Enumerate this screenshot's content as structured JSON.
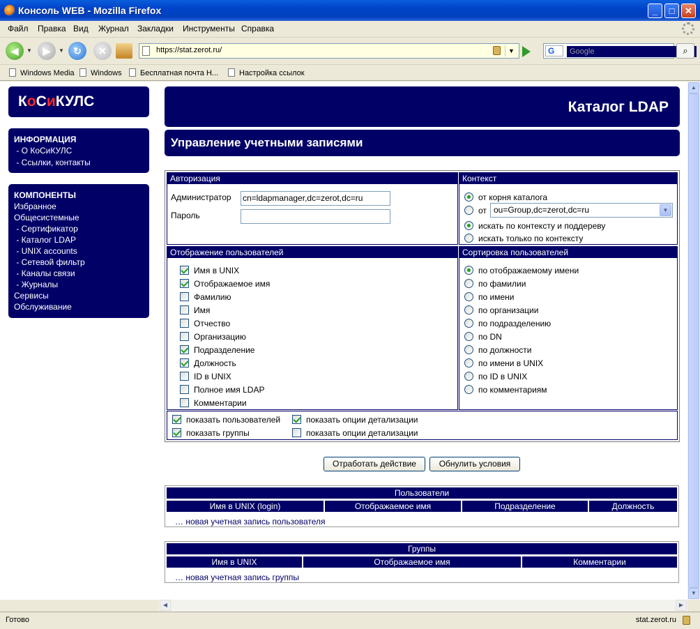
{
  "window": {
    "title": "Консоль WEB - Mozilla Firefox",
    "min": "_",
    "max": "□",
    "close": "✕"
  },
  "menu": [
    "Файл",
    "Правка",
    "Вид",
    "Журнал",
    "Закладки",
    "Инструменты",
    "Справка"
  ],
  "nav": {
    "url": "https://stat.zerot.ru/",
    "search_placeholder": "Google",
    "search_engine": "G"
  },
  "bookmarks": [
    "Windows Media",
    "Windows",
    "Бесплатная почта H...",
    "Настройка ссылок"
  ],
  "status": {
    "text": "Готово",
    "host": "stat.zerot.ru"
  },
  "page": {
    "logo": {
      "k": "К",
      "o": "о",
      "s": "С",
      "i": "и",
      "kuls": "КУЛС"
    },
    "info": {
      "heading": "ИНФОРМАЦИЯ",
      "items": [
        " - О КоСиКУЛС",
        " - Ссылки, контакты"
      ]
    },
    "components": {
      "heading": "КОМПОНЕНТЫ",
      "items": [
        "Избранное",
        "Общесистемные",
        " - Сертификатор",
        " - Каталог LDAP",
        " - UNIX accounts",
        " - Сетевой фильтр",
        " - Каналы связи",
        " - Журналы",
        "Сервисы",
        "Обслуживание"
      ]
    },
    "header_title": "Каталог LDAP",
    "section_title": "Управление учетными записями",
    "auth": {
      "heading": "Авторизация",
      "admin_label": "Администратор",
      "admin_value": "cn=ldapmanager,dc=zerot,dc=ru",
      "password_label": "Пароль",
      "password_value": ""
    },
    "context": {
      "heading": "Контекст",
      "from_root": "от корня каталога",
      "from": "от",
      "from_value": "ou=Group,dc=zerot,dc=ru",
      "subtree": "искать по контексту и поддереву",
      "only": "искать только по контексту"
    },
    "display": {
      "heading": "Отображение пользователей",
      "items": [
        {
          "label": "Имя в UNIX",
          "checked": true
        },
        {
          "label": "Отображаемое имя",
          "checked": true
        },
        {
          "label": "Фамилию",
          "checked": false
        },
        {
          "label": "Имя",
          "checked": false
        },
        {
          "label": "Отчество",
          "checked": false
        },
        {
          "label": "Организацию",
          "checked": false
        },
        {
          "label": "Подразделение",
          "checked": true
        },
        {
          "label": "Должность",
          "checked": true
        },
        {
          "label": "ID в UNIX",
          "checked": false
        },
        {
          "label": "Полное имя LDAP",
          "checked": false
        },
        {
          "label": "Комментарии",
          "checked": false
        }
      ]
    },
    "sort": {
      "heading": "Сортировка пользователей",
      "items": [
        "по отображаемому имени",
        "по фамилии",
        "по имени",
        "по организации",
        "по подразделению",
        "по DN",
        "по должности",
        "по имени в UNIX",
        "по ID в UNIX",
        "по комментариям"
      ],
      "selected": 0
    },
    "options": {
      "show_users": "показать пользователей",
      "show_groups": "показать группы",
      "detail1": "показать опции детализации",
      "detail2": "показать опции детализации"
    },
    "buttons": {
      "apply": "Отработать действие",
      "reset": "Обнулить условия"
    },
    "users_table": {
      "title": "Пользователи",
      "columns": [
        "Имя в UNIX (login)",
        "Отображаемое имя",
        "Подразделение",
        "Должность"
      ],
      "new_link": "… новая учетная запись пользователя"
    },
    "groups_table": {
      "title": "Группы",
      "columns": [
        "Имя в UNIX",
        "Отображаемое имя",
        "Комментарии"
      ],
      "new_link": "… новая учетная запись группы"
    }
  }
}
